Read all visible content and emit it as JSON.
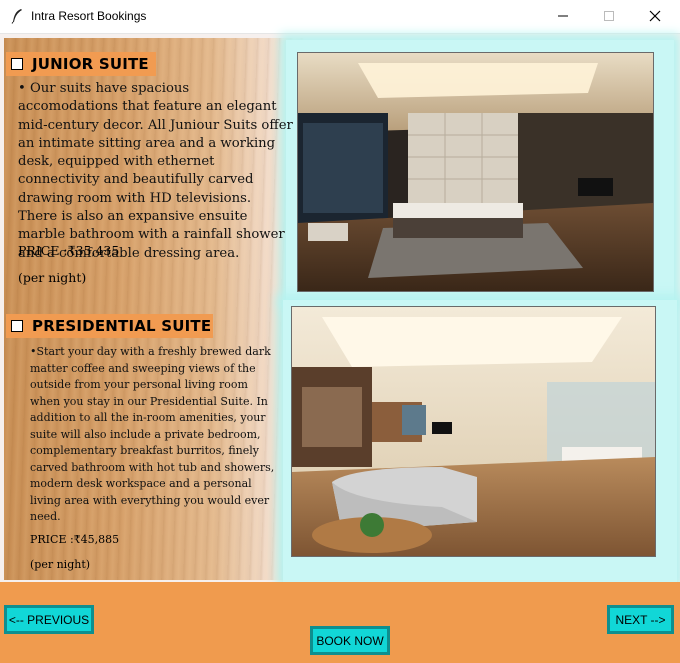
{
  "window": {
    "title": "Intra Resort Bookings"
  },
  "suites": [
    {
      "name": "JUNIOR SUITE",
      "description": "• Our suits have spacious accomodations that feature an elegant mid-century decor. All Juniour Suits offer an intimate sitting area and a working desk, equipped with ethernet connectivity and beautifully carved drawing room with HD televisions. There is also an expansive ensuite marble bathroom with a rainfall shower and a comfortable dressing area.",
      "price": "PRICE :₹35,435",
      "per_night": "(per night)",
      "checked": false
    },
    {
      "name": "PRESIDENTIAL SUITE",
      "description": "•Start your day with a freshly brewed dark matter coffee and sweeping views of the outside from your personal living room when you stay in our Presidential Suite. In addition to all the in-room amenities, your suite will also include a private bedroom, complementary breakfast burritos, finely carved bathroom with hot tub and showers, modern desk workspace and a personal living area with everything you would ever need.",
      "price": "PRICE :₹45,885",
      "per_night": "(per night)",
      "checked": false
    }
  ],
  "buttons": {
    "previous": "<-- PREVIOUS",
    "next": "NEXT -->",
    "book": "BOOK NOW"
  },
  "colors": {
    "accent_orange": "#f19b51",
    "button_cyan": "#11d7d7",
    "button_border": "#0e8f8f"
  }
}
